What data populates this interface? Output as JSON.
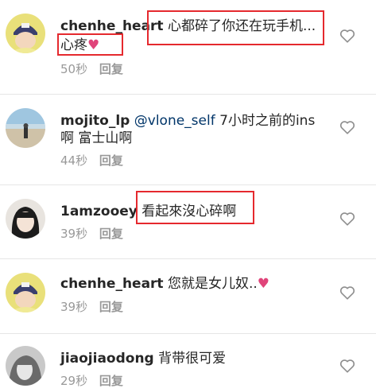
{
  "comments": [
    {
      "username": "chenhe_heart",
      "text_line1": "心都碎了你还在玩手机...",
      "text_line2": "心疼",
      "emoji": "pink-heart",
      "time": "50秒",
      "reply": "回复"
    },
    {
      "username": "mojito_lp",
      "mention": "@vlone_self",
      "text_line1": "7小时之前的ins",
      "text_line2": "啊 富士山啊",
      "time": "44秒",
      "reply": "回复"
    },
    {
      "username": "1amzooey",
      "text_line1": "看起來沒心碎啊",
      "time": "39秒",
      "reply": "回复"
    },
    {
      "username": "chenhe_heart",
      "text_line1": "您就是女儿奴..",
      "emoji": "pink-heart",
      "time": "39秒",
      "reply": "回复"
    },
    {
      "username": "jiaojiaodong",
      "text_line1": "背带很可爱",
      "time": "29秒",
      "reply": "回复"
    }
  ],
  "icons": {
    "like": "heart-outline-icon",
    "emoji": "pink-heart-icon"
  },
  "colors": {
    "highlight_box": "#e5292e",
    "emoji_heart": "#e0447a",
    "mention": "#003569",
    "meta": "#999999"
  }
}
